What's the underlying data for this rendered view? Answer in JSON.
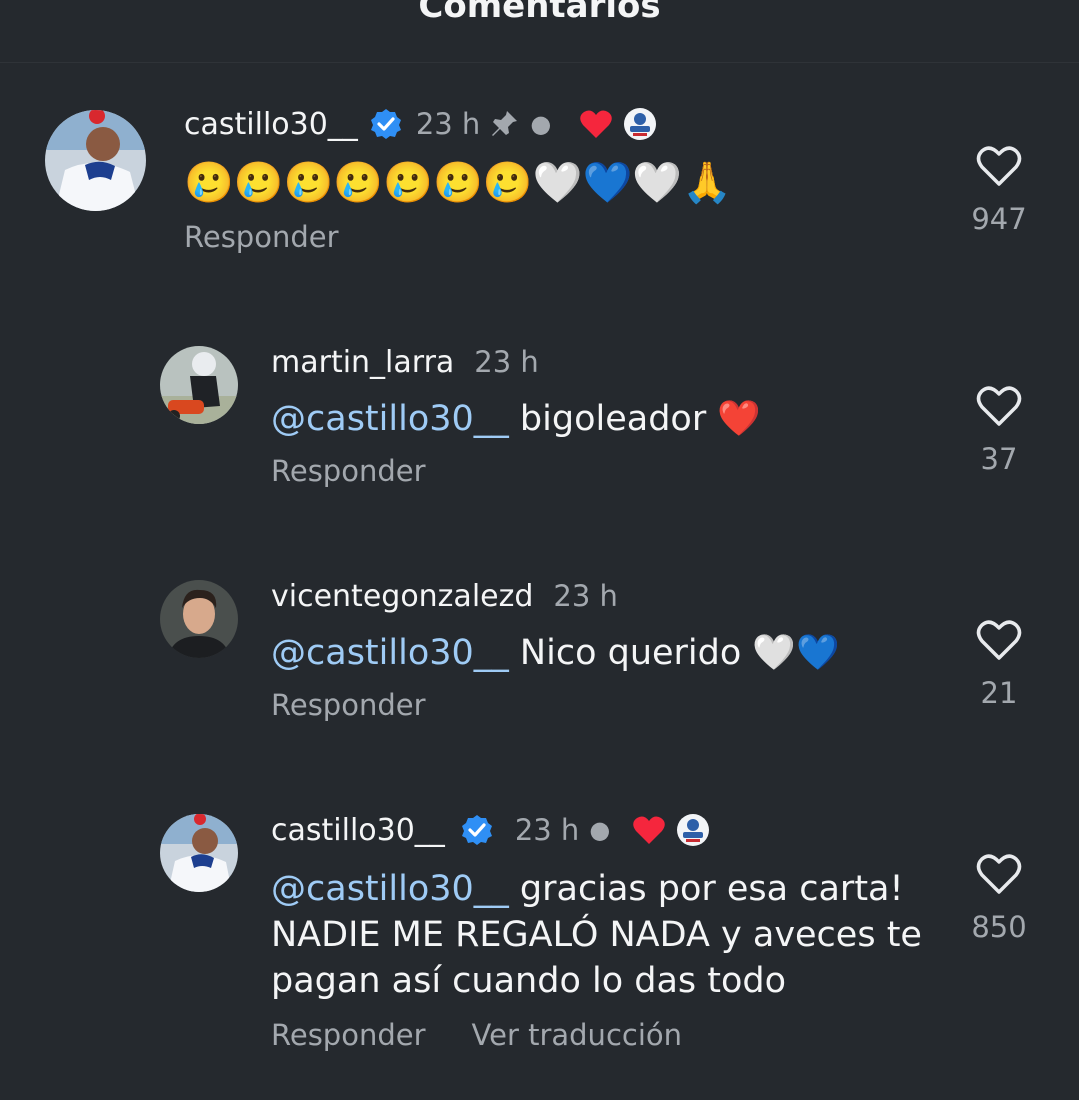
{
  "header": {
    "title": "Comentarios"
  },
  "colors": {
    "background": "#25292e",
    "mention": "#9fcbf5",
    "verified": "#2f8ff5",
    "heart": "#f5263d",
    "muted": "#a3a8ae"
  },
  "comments": [
    {
      "username": "castillo30__",
      "verified": true,
      "time": "23 h",
      "pinned": true,
      "liked_by_author": true,
      "text": "🥲🥲🥲🥲🥲🥲🥲🤍💙🤍🙏",
      "reply_label": "Responder",
      "likes": "947"
    },
    {
      "username": "martin_larra",
      "verified": false,
      "time": "23 h",
      "mention": "@castillo30__",
      "text": "bigoleador ❤️",
      "reply_label": "Responder",
      "likes": "37"
    },
    {
      "username": "vicentegonzalezd",
      "verified": false,
      "time": "23 h",
      "mention": "@castillo30__",
      "text": "Nico querido 🤍💙",
      "reply_label": "Responder",
      "likes": "21"
    },
    {
      "username": "castillo30__",
      "verified": true,
      "time": "23 h",
      "liked_by_author": true,
      "mention": "@castillo30__",
      "text_line1": "gracias por esa carta!",
      "text_line2": "NADIE ME REGALÓ NADA y aveces te",
      "text_line3": "pagan así cuando lo das todo",
      "reply_label": "Responder",
      "translate_label": "Ver traducción",
      "likes": "850"
    }
  ]
}
